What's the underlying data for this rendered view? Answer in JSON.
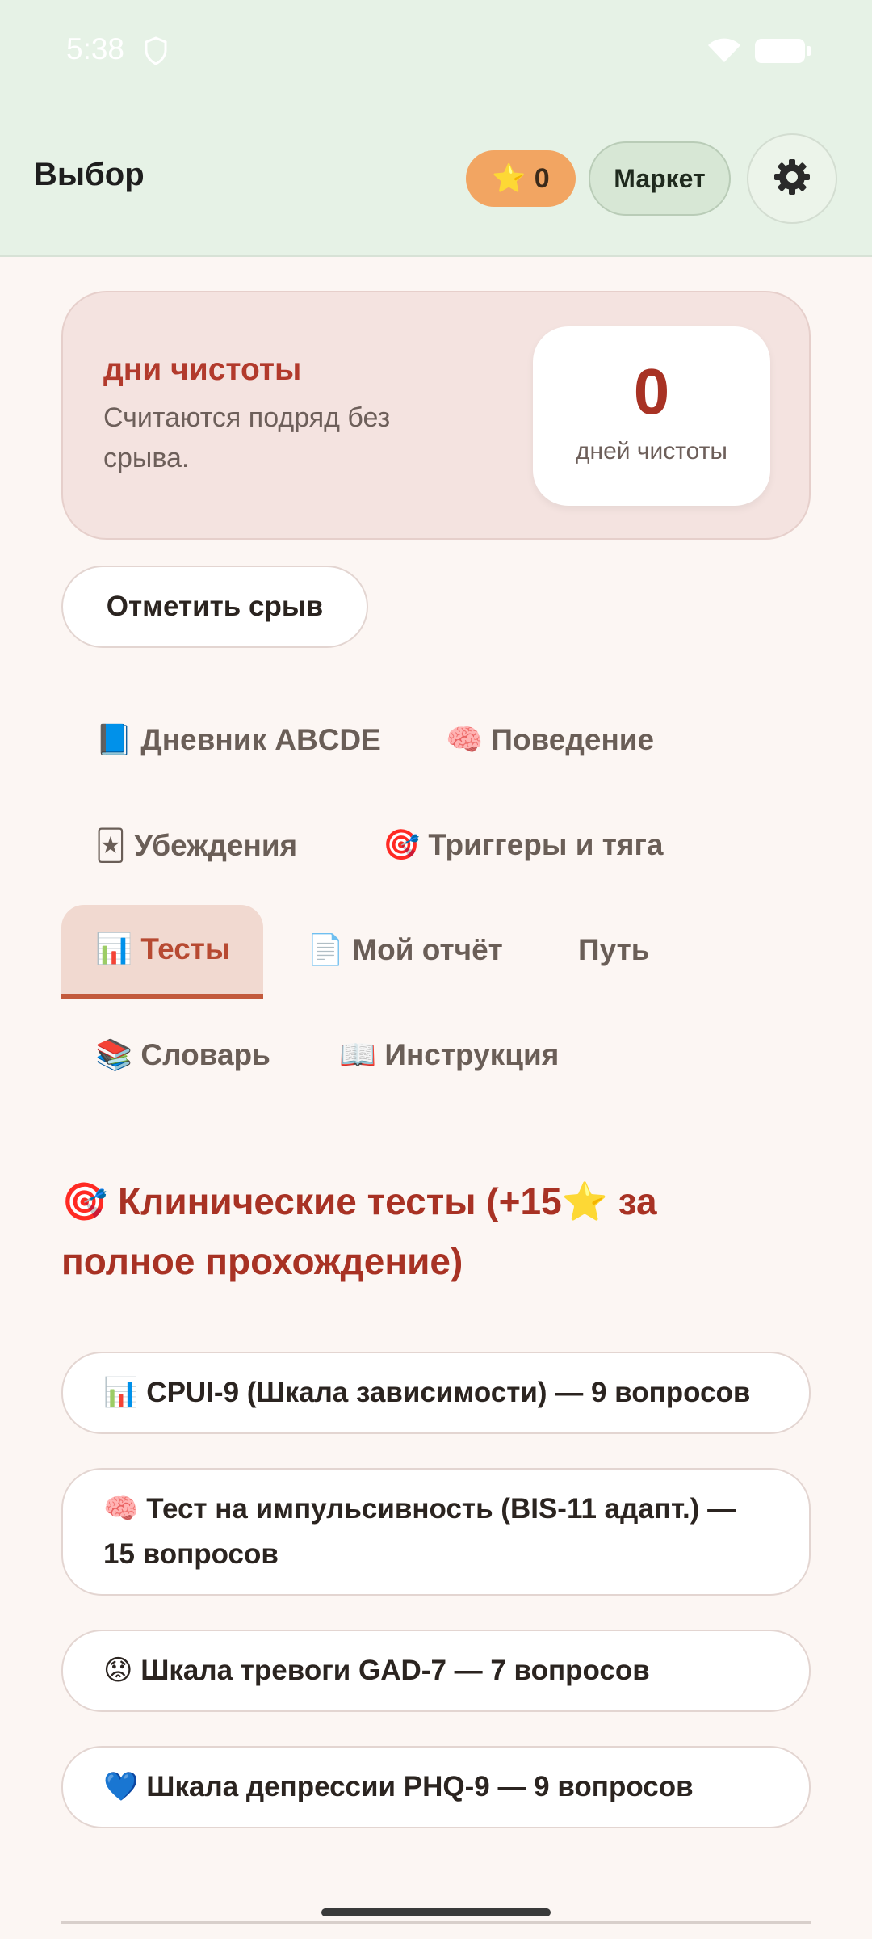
{
  "status_bar": {
    "time": "5:38"
  },
  "header": {
    "title": "Выбор",
    "coins": {
      "icon": "⭐",
      "value": "0"
    },
    "market_label": "Маркет",
    "settings_icon": "gear-icon"
  },
  "streak": {
    "title": "дни чистоты",
    "subtitle": "Считаются подряд без срыва.",
    "count": "0",
    "count_label": "дней чистоты"
  },
  "relapse_button": "Отметить срыв",
  "tabs": [
    {
      "label": "📘 Дневник ABCDE",
      "active": false
    },
    {
      "label": "🧠 Поведение",
      "active": false
    },
    {
      "label": "🃏 Убеждения",
      "active": false
    },
    {
      "label": "🎯 Триггеры и тяга",
      "active": false
    },
    {
      "label": "📊 Тесты",
      "active": true
    },
    {
      "label": "📄 Мой отчёт",
      "active": false
    },
    {
      "label": "Путь",
      "active": false
    },
    {
      "label": "📚 Словарь",
      "active": false
    },
    {
      "label": "📖 Инструкция",
      "active": false
    }
  ],
  "tests_section": {
    "title": "🎯 Клинические тесты (+15⭐ за полное прохождение)",
    "items": [
      "📊 CPUI-9 (Шкала зависимости) — 9 вопросов",
      "🧠 Тест на импульсивность (BIS-11 адапт.) — 15 вопросов",
      "😟 Шкала тревоги GAD-7 — 7 вопросов",
      "💙 Шкала депрессии PHQ-9 — 9 вопросов"
    ]
  },
  "colors": {
    "accent": "#a83224",
    "header_bg": "#e6f2e6",
    "coin_pill": "#f2a562",
    "active_tab_underline": "#c35a3c"
  }
}
